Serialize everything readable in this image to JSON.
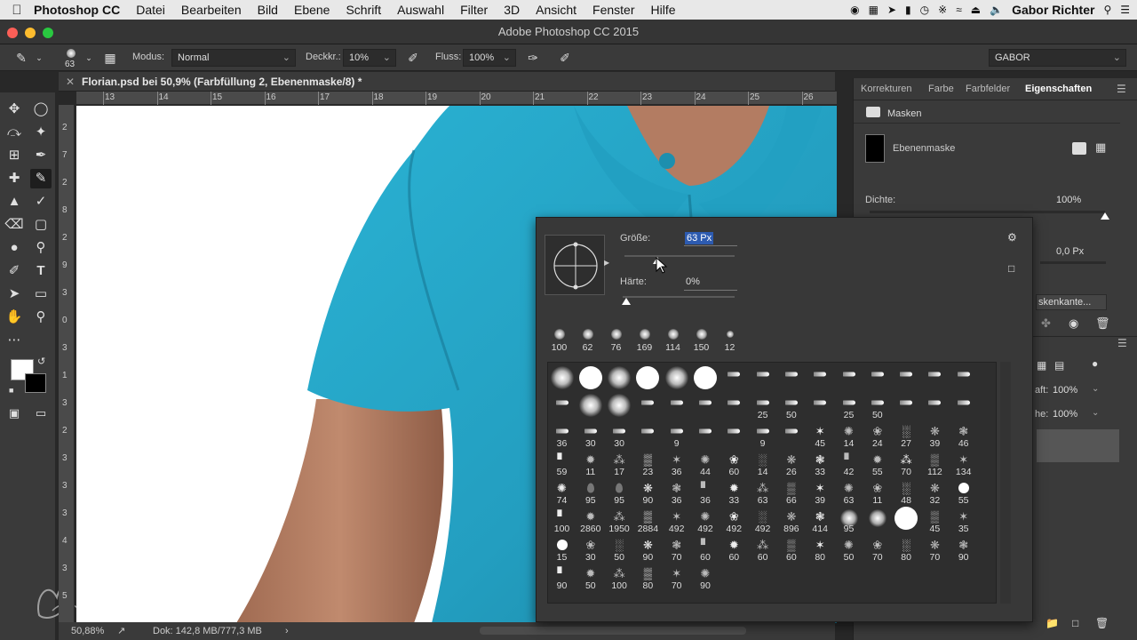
{
  "menubar": {
    "app": "Photoshop CC",
    "items": [
      "Datei",
      "Bearbeiten",
      "Bild",
      "Ebene",
      "Schrift",
      "Auswahl",
      "Filter",
      "3D",
      "Ansicht",
      "Fenster",
      "Hilfe"
    ],
    "user": "Gabor Richter"
  },
  "window": {
    "title": "Adobe Photoshop CC 2015"
  },
  "options": {
    "brush_size": "63",
    "mode_label": "Modus:",
    "mode_value": "Normal",
    "opacity_label": "Deckkr.:",
    "opacity_value": "10%",
    "flow_label": "Fluss:",
    "flow_value": "100%",
    "workspace": "GABOR"
  },
  "document": {
    "tab_title": "Florian.psd bei 50,9% (Farbfüllung 2, Ebenenmaske/8) *",
    "ruler_h": [
      "13",
      "14",
      "15",
      "16",
      "17",
      "18",
      "19",
      "20",
      "21",
      "22",
      "23",
      "24",
      "25",
      "26"
    ],
    "ruler_v": [
      "2",
      "7",
      "2",
      "8",
      "2",
      "9",
      "3",
      "0",
      "3",
      "1",
      "3",
      "2",
      "3",
      "3",
      "3",
      "4",
      "3",
      "5"
    ]
  },
  "status": {
    "zoom": "50,88%",
    "doc": "Dok: 142,8 MB/777,3 MB"
  },
  "panel": {
    "tabs": [
      "Korrekturen",
      "Farbe",
      "Farbfelder",
      "Eigenschaften"
    ],
    "masks_label": "Masken",
    "layer_mask_label": "Ebenenmaske",
    "density_label": "Dichte:",
    "density_value": "100%",
    "feather_value": "0,0 Px",
    "mask_edge_button": "skenkante...",
    "opacity_value": "100%",
    "fill_value": "100%",
    "opacity_label_partial": "aft:",
    "fill_label_partial": "he:"
  },
  "brushpicker": {
    "size_label": "Größe:",
    "size_value": "63 Px",
    "hardness_label": "Härte:",
    "hardness_value": "0%",
    "size_slider_fraction": 0.3,
    "hardness_slider_fraction": 0.0,
    "recent": [
      "100",
      "62",
      "76",
      "169",
      "114",
      "150",
      "12"
    ],
    "rows": [
      [
        "",
        "",
        "",
        "",
        "",
        "",
        "",
        "",
        "",
        "",
        "",
        "",
        "",
        "",
        ""
      ],
      [
        "",
        "",
        "",
        "",
        "",
        "",
        "",
        "25",
        "50",
        "",
        "25",
        "50",
        "",
        "",
        ""
      ],
      [
        "36",
        "30",
        "30",
        "",
        "9",
        "",
        "",
        "9",
        "",
        "45",
        "14",
        "24",
        "27",
        "39",
        "46"
      ],
      [
        "59",
        "11",
        "17",
        "23",
        "36",
        "44",
        "60",
        "14",
        "26",
        "33",
        "42",
        "55",
        "70",
        "112",
        "134"
      ],
      [
        "74",
        "95",
        "95",
        "90",
        "36",
        "36",
        "33",
        "63",
        "66",
        "39",
        "63",
        "11",
        "48",
        "32",
        "55"
      ],
      [
        "100",
        "2860",
        "1950",
        "2884",
        "492",
        "492",
        "492",
        "492",
        "896",
        "414",
        "95",
        "",
        "",
        "45",
        "35"
      ],
      [
        "15",
        "30",
        "50",
        "90",
        "70",
        "60",
        "60",
        "60",
        "60",
        "80",
        "50",
        "70",
        "80",
        "70",
        "90"
      ],
      [
        "90",
        "50",
        "100",
        "80",
        "70",
        "90"
      ]
    ]
  },
  "colors": {
    "shirt": "#2aa3c4",
    "ui_dark": "#383838",
    "highlight": "#2d5bb0"
  }
}
